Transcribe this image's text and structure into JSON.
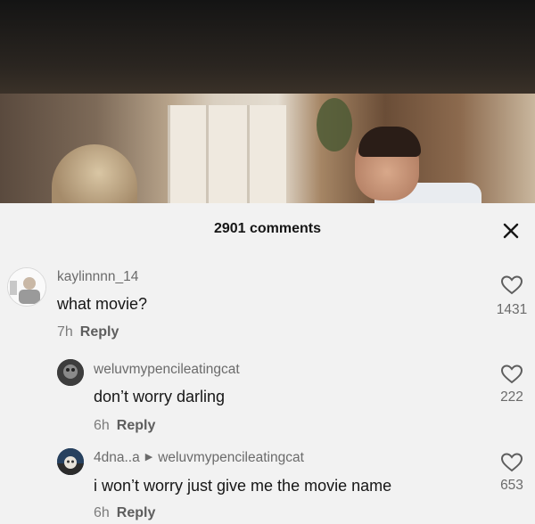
{
  "header": {
    "comment_count": "2901 comments",
    "close_icon": "close-icon"
  },
  "comments": [
    {
      "username": "kaylinnnn_14",
      "text": "what movie?",
      "time": "7h",
      "reply_label": "Reply",
      "likes": "1431"
    },
    {
      "username": "weluvmypencileatingcat",
      "text": "don’t worry darling",
      "time": "6h",
      "reply_label": "Reply",
      "likes": "222"
    },
    {
      "username": "4dna..a",
      "reply_to": "weluvmypencileatingcat",
      "text": "i won’t worry just give me the movie name",
      "time": "6h",
      "reply_label": "Reply",
      "likes": "653"
    }
  ],
  "colors": {
    "background": "#f2f2f2",
    "text": "#161616",
    "muted": "#7c7c7c"
  },
  "icons": {
    "like": "heart-icon",
    "reply_arrow": "caret-right-icon"
  }
}
